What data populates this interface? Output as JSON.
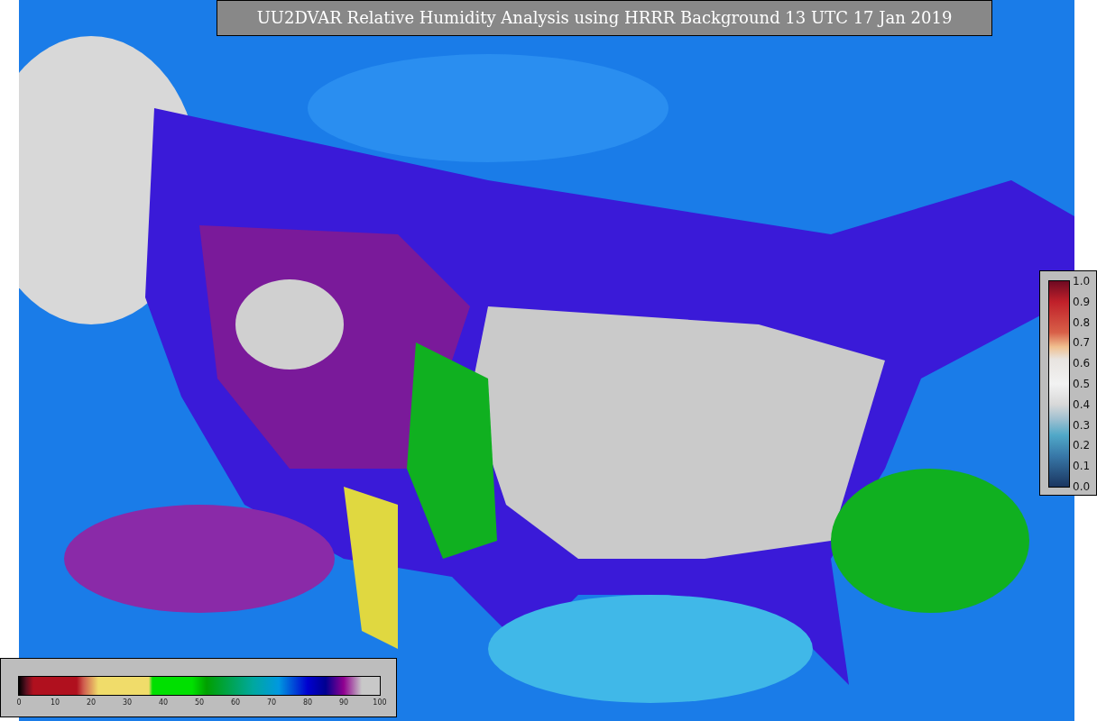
{
  "title": "UU2DVAR Relative Humidity Analysis using HRRR Background 13 UTC 17 Jan 2019",
  "horizontal_colorbar": {
    "ticks": [
      "0",
      "10",
      "20",
      "30",
      "40",
      "50",
      "60",
      "70",
      "80",
      "90",
      "100"
    ]
  },
  "vertical_colorbar": {
    "ticks": [
      "1.0",
      "0.9",
      "0.8",
      "0.7",
      "0.6",
      "0.5",
      "0.4",
      "0.3",
      "0.2",
      "0.1",
      "0.0"
    ]
  }
}
